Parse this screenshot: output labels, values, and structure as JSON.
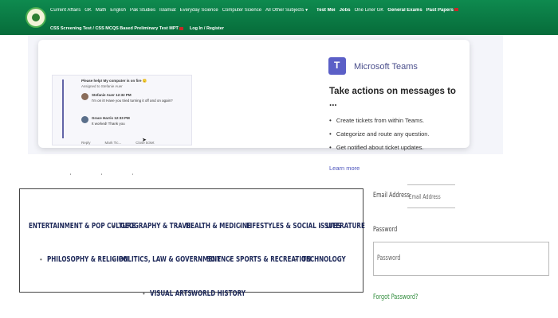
{
  "nav": {
    "row1": [
      {
        "label": "Current Affairs",
        "bold": false,
        "caret": false,
        "flag": false
      },
      {
        "label": "GK",
        "bold": false,
        "caret": false,
        "flag": false
      },
      {
        "label": "Math",
        "bold": false,
        "caret": false,
        "flag": false
      },
      {
        "label": "English",
        "bold": false,
        "caret": false,
        "flag": false
      },
      {
        "label": "Pak Studies",
        "bold": false,
        "caret": false,
        "flag": false
      },
      {
        "label": "Islamiat",
        "bold": false,
        "caret": false,
        "flag": false
      },
      {
        "label": "Everyday Science",
        "bold": false,
        "caret": false,
        "flag": false
      },
      {
        "label": "Computer Science",
        "bold": false,
        "caret": false,
        "flag": false
      },
      {
        "label": "All Other Subjects",
        "bold": false,
        "caret": true,
        "flag": false
      },
      {
        "label": "Test Mei",
        "bold": true,
        "caret": false,
        "flag": false
      },
      {
        "label": "Jobs",
        "bold": true,
        "caret": false,
        "flag": false
      },
      {
        "label": "One Liner GK",
        "bold": false,
        "caret": false,
        "flag": false
      },
      {
        "label": "General Exams",
        "bold": true,
        "caret": false,
        "flag": false
      },
      {
        "label": "Past Papers",
        "bold": true,
        "caret": false,
        "flag": true
      }
    ],
    "row2": [
      {
        "label": "CSS Screening Test / CSS MCQS Based Preliminary Test MPT",
        "flag": true
      },
      {
        "label": "Log In / Register",
        "flag": false
      }
    ]
  },
  "ad": {
    "brand": "Microsoft Teams",
    "title": "Take actions on messages to ...",
    "bullets": [
      "Create tickets from within Teams.",
      "Categorize and route any question.",
      "Get notified about ticket updates."
    ],
    "learn_more": "Learn more",
    "chat": {
      "header": "Please help! My computer is on fire 🙂",
      "sub": "Assigned to Stefanie Auer",
      "messages": [
        {
          "name": "Stefanie Auer  12:32 PM",
          "text": "I'm on it! Have you tried turning it off and on again?"
        },
        {
          "name": "Grace Harris  12:33 PM",
          "text": "It worked! Thank you"
        }
      ],
      "actions": [
        "Reply",
        "Mark Tic...",
        "Close ticket"
      ]
    }
  },
  "tick_marks": "' ' '",
  "categories": [
    "ENTERTAINMENT & POP CULTURE",
    "GEOGRAPHY & TRAVEL",
    "HEALTH & MEDICINE",
    "LIFESTYLES & SOCIAL ISSUES",
    "LITERATURE",
    "PHILOSOPHY & RELIGION",
    "POLITICS, LAW & GOVERNMENT",
    "SCIENCE",
    "SPORTS & RECREATION",
    "TECHNOLOGY",
    "VISUAL ARTS",
    "WORLD HISTORY"
  ],
  "login": {
    "email_label": "Email Address",
    "email_placeholder": "Email Address",
    "password_label": "Password",
    "password_placeholder": "Password",
    "forgot": "Forgot Password?"
  },
  "colors": {
    "nav_green": "#0b7d45",
    "teams_purple": "#5b5fc7",
    "category_text": "#1f2a5a",
    "forgot_link": "#2e8b3a"
  }
}
